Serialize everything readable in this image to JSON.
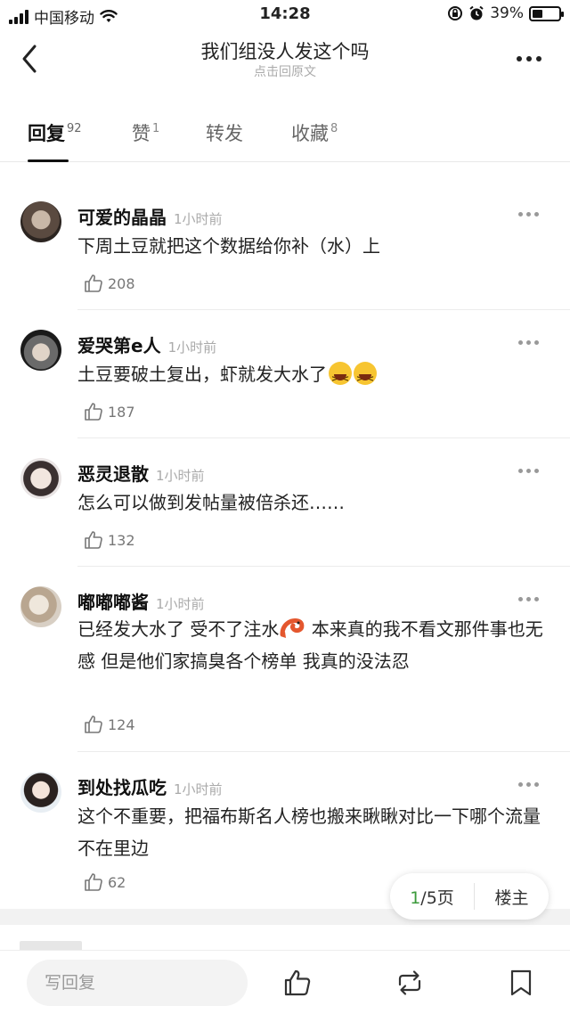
{
  "status_bar": {
    "carrier": "中国移动",
    "time": "14:28",
    "battery": "39%",
    "battery_level": 0.39
  },
  "nav": {
    "title": "我们组没人发这个吗",
    "subtitle": "点击回原文"
  },
  "tabs": [
    {
      "label": "回复",
      "count": "92"
    },
    {
      "label": "赞",
      "count": "1"
    },
    {
      "label": "转发",
      "count": ""
    },
    {
      "label": "收藏",
      "count": "8"
    }
  ],
  "comments": [
    {
      "name": "可爱的晶晶",
      "time": "1小时前",
      "text": "下周土豆就把这个数据给你补（水）上",
      "likes": "208"
    },
    {
      "name": "爱哭第e人",
      "time": "1小时前",
      "text": "土豆要破土复出，虾就发大水了",
      "likes": "187"
    },
    {
      "name": "恶灵退散",
      "time": "1小时前",
      "text": "怎么可以做到发帖量被倍杀还……",
      "likes": "132"
    },
    {
      "name": "嘟嘟嘟酱",
      "time": "1小时前",
      "text_a": "已经发大水了 受不了注水",
      "text_b": " 本来真的我不看文那件事也无感 但是他们家搞臭各个榜单 我真的没法忍",
      "likes": "124"
    },
    {
      "name": "到处找瓜吃",
      "time": "1小时前",
      "text": "这个不重要，把福布斯名人榜也搬来瞅瞅对比一下哪个流量不在里边",
      "likes": "62"
    }
  ],
  "pager": {
    "current": "1",
    "total": "/5页",
    "host_label": "楼主"
  },
  "bottom_bar": {
    "reply_placeholder": "写回复"
  }
}
